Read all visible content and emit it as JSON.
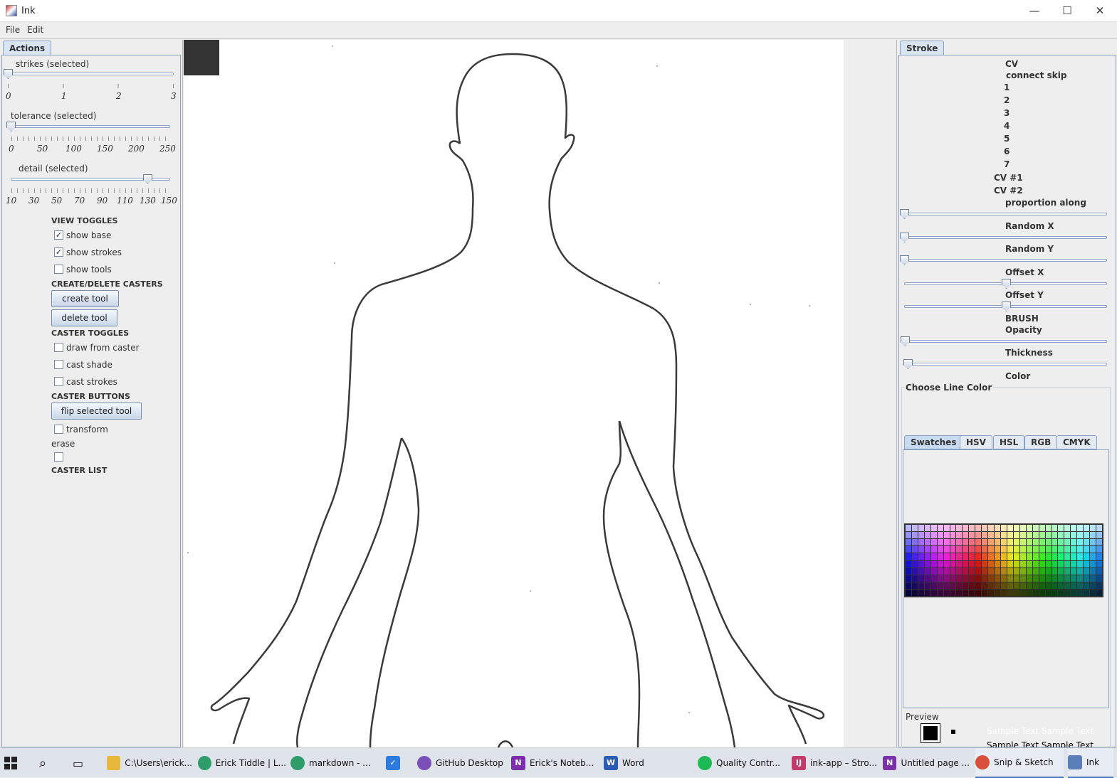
{
  "window": {
    "title": "Ink",
    "minimize": "—",
    "maximize": "☐",
    "close": "✕"
  },
  "menu": {
    "file": "File",
    "edit": "Edit"
  },
  "left": {
    "tab": "Actions",
    "strikes_label": "strikes (selected)",
    "strikes_ticks": [
      "0",
      "1",
      "2",
      "3"
    ],
    "strikes_value": 0,
    "tolerance_label": "tolerance (selected)",
    "tolerance_ticks": [
      "0",
      "50",
      "100",
      "150",
      "200",
      "250"
    ],
    "tolerance_value": 0,
    "detail_label": "detail (selected)",
    "detail_ticks": [
      "10",
      "30",
      "50",
      "70",
      "90",
      "110",
      "130",
      "150"
    ],
    "detail_value": 130,
    "view_toggles": "VIEW TOGGLES",
    "show_base": "show base",
    "show_strokes": "show strokes",
    "show_tools": "show tools",
    "create_delete": "CREATE/DELETE CASTERS",
    "create_tool": "create tool",
    "delete_tool": "delete tool",
    "caster_toggles": "CASTER TOGGLES",
    "draw_from_caster": "draw from caster",
    "cast_shade": "cast shade",
    "cast_strokes": "cast strokes",
    "caster_buttons": "CASTER BUTTONS",
    "flip_selected_tool": "flip selected tool",
    "transform": "transform",
    "erase": "erase",
    "caster_list": "CASTER LIST",
    "check_mark": "✓"
  },
  "right": {
    "tab": "Stroke",
    "cv": "CV",
    "connect_skip": "connect skip",
    "skip_items": [
      "1",
      "2",
      "3",
      "4",
      "5",
      "6",
      "7"
    ],
    "cv1": "CV #1",
    "cv2": "CV #2",
    "proportion_along": "proportion along",
    "random_x": "Random X",
    "random_y": "Random Y",
    "offset_x": "Offset X",
    "offset_y": "Offset Y",
    "brush": "BRUSH",
    "opacity": "Opacity",
    "thickness": "Thickness",
    "color": "Color",
    "choose_line_color": "Choose Line Color",
    "color_tabs": [
      "Swatches",
      "HSV",
      "HSL",
      "RGB",
      "CMYK"
    ],
    "preview": "Preview",
    "sample_text": "Sample Text  Sample Text"
  },
  "taskbar": [
    {
      "label": "",
      "icon": "windows-start-icon"
    },
    {
      "label": "",
      "icon": "search-icon"
    },
    {
      "label": "",
      "icon": "task-view-icon"
    },
    {
      "label": "C:\\Users\\erick...",
      "icon": "folder-icon"
    },
    {
      "label": "Erick Tiddle | L...",
      "icon": "edge-dev-icon"
    },
    {
      "label": "markdown - ...",
      "icon": "edge-dev-icon"
    },
    {
      "label": "",
      "icon": "todo-icon"
    },
    {
      "label": "GitHub Desktop",
      "icon": "github-desktop-icon"
    },
    {
      "label": "Erick's Noteb...",
      "icon": "onenote-icon"
    },
    {
      "label": "Word",
      "icon": "word-icon"
    },
    {
      "label": "Quality Contr...",
      "icon": "spotify-icon"
    },
    {
      "label": "ink-app – Stro...",
      "icon": "intellij-icon"
    },
    {
      "label": "Untitled page ...",
      "icon": "onenote-icon"
    },
    {
      "label": "Snip & Sketch",
      "icon": "snip-sketch-icon"
    },
    {
      "label": "Ink",
      "icon": "java-icon"
    }
  ]
}
